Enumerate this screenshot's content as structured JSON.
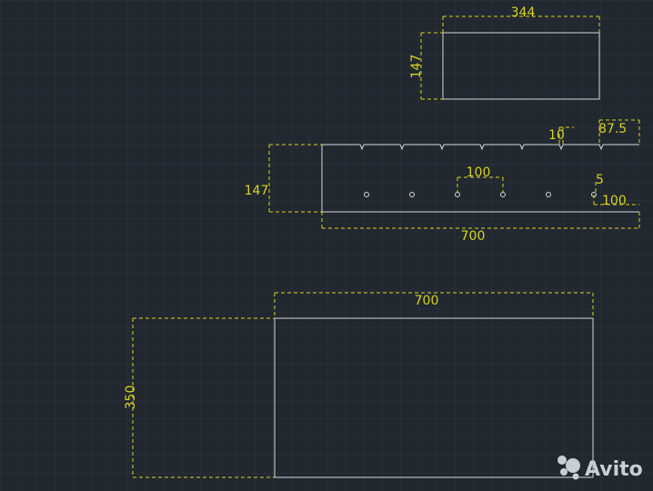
{
  "colors": {
    "background": "#212830",
    "grid": "#2d353e",
    "geometry": "#d6d9dc",
    "dimension": "#d8d31e",
    "watermark": "#c9ced3"
  },
  "dimensions": {
    "top_width": "344",
    "top_height": "147",
    "middle_tick": "10",
    "middle_end_offset": "87.5",
    "middle_hole_spacing": "100",
    "middle_hole_offset": "5",
    "middle_edge_hole": "100",
    "middle_height": "147",
    "middle_width": "700",
    "bottom_width": "700",
    "bottom_height": "350"
  },
  "watermark": {
    "text": "Avito",
    "icon": "avito-logo-icon"
  }
}
